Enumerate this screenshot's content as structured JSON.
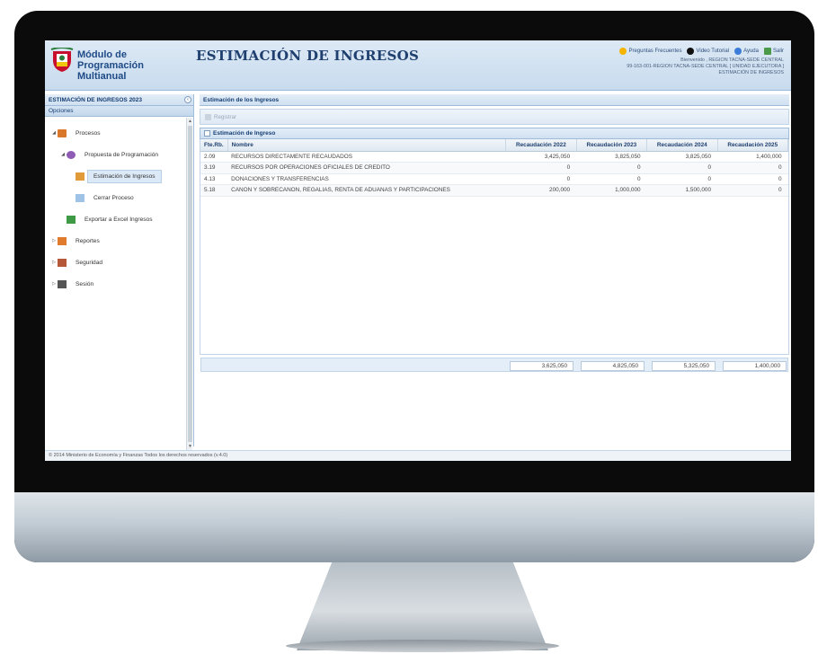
{
  "header": {
    "module_title_line1": "Módulo de Programación",
    "module_title_line2": "Multianual",
    "page_heading": "ESTIMACIÓN DE INGRESOS",
    "links": {
      "faq": "Preguntas Frecuentes",
      "video": "Video Tutorial",
      "help": "Ayuda",
      "exit": "Salir"
    },
    "user_line1": "Bienvenido , REGION TACNA-SEDE CENTRAL",
    "user_line2": "99-163-001-REGION TACNA-SEDE CENTRAL [ UNIDAD EJECUTORA ]",
    "user_line3": "ESTIMACIÓN DE INGRESOS"
  },
  "sidebar": {
    "title": "ESTIMACIÓN DE INGRESOS 2023",
    "options_label": "Opciones",
    "items": [
      {
        "label": "Procesos",
        "icon": "folder-icon"
      },
      {
        "label": "Propuesta de Programación",
        "icon": "gear-icon"
      },
      {
        "label": "Estimación de Ingresos",
        "icon": "edit-icon"
      },
      {
        "label": "Cerrar Proceso",
        "icon": "document-icon"
      },
      {
        "label": "Exportar a Excel Ingresos",
        "icon": "excel-icon"
      },
      {
        "label": "Reportes",
        "icon": "report-icon"
      },
      {
        "label": "Seguridad",
        "icon": "users-icon"
      },
      {
        "label": "Sesión",
        "icon": "tools-icon"
      }
    ]
  },
  "main": {
    "panel_title": "Estimación de los Ingresos",
    "toolbar_register": "Registrar",
    "grid_title": "Estimación de Ingreso",
    "columns": [
      "Fte.Rb.",
      "Nombre",
      "Recaudación 2022",
      "Recaudación 2023",
      "Recaudación 2024",
      "Recaudación 2025"
    ],
    "rows": [
      [
        "2.09",
        "RECURSOS DIRECTAMENTE RECAUDADOS",
        "3,425,050",
        "3,825,050",
        "3,825,050",
        "1,400,000"
      ],
      [
        "3.19",
        "RECURSOS POR OPERACIONES OFICIALES DE CREDITO",
        "0",
        "0",
        "0",
        "0"
      ],
      [
        "4.13",
        "DONACIONES Y TRANSFERENCIAS",
        "0",
        "0",
        "0",
        "0"
      ],
      [
        "5.18",
        "CANON Y SOBRECANON, REGALIAS, RENTA DE ADUANAS Y PARTICIPACIONES",
        "200,000",
        "1,000,000",
        "1,500,000",
        "0"
      ]
    ],
    "totals": [
      "3,625,050",
      "4,825,050",
      "5,325,050",
      "1,400,000"
    ]
  },
  "footer": {
    "text": "© 2014 Ministerio de Economía y Finanzas Todos los derechos reservados (v.4.0)"
  }
}
